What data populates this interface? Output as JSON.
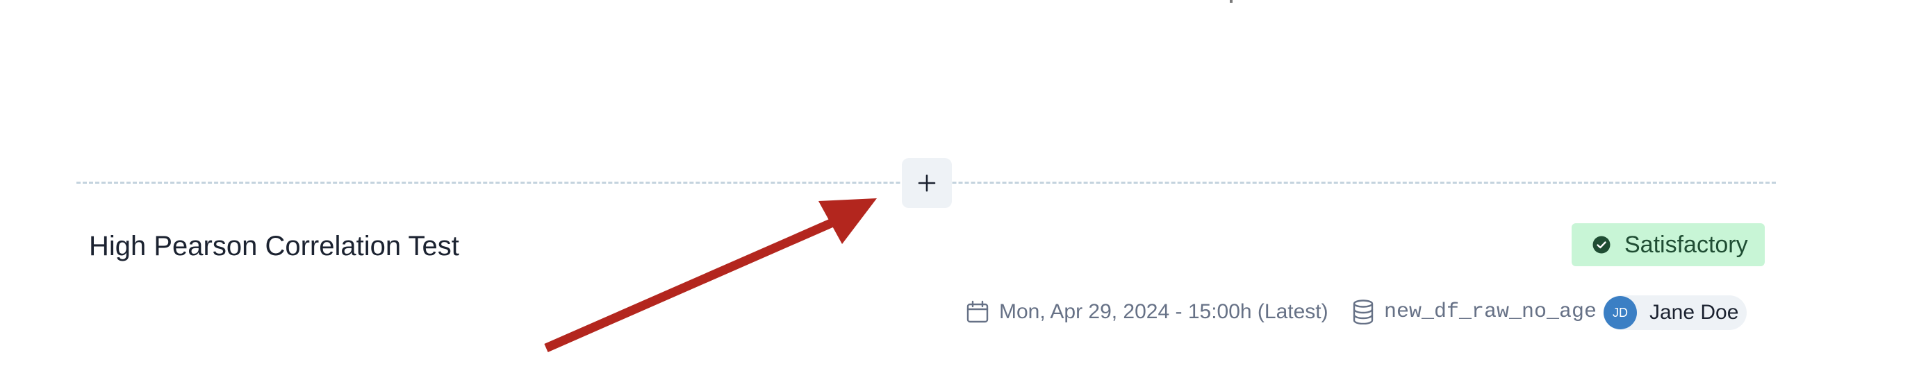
{
  "add_section": {
    "icon": "plus-icon"
  },
  "test": {
    "title": "High Pearson Correlation Test",
    "status": {
      "label": "Satisfactory",
      "icon": "check-circle-icon",
      "background": "#c8f5d6",
      "text_color": "#1f4d33",
      "icon_color": "#1f4d33"
    },
    "meta": {
      "date": "Mon, Apr 29, 2024 - 15:00h (Latest)",
      "date_icon": "calendar-icon",
      "dataset": "new_df_raw_no_age",
      "dataset_icon": "database-icon"
    },
    "author": {
      "initials": "JD",
      "name": "Jane Doe",
      "avatar_color": "#3b7fc4"
    }
  },
  "annotation": {
    "color": "#b3261e",
    "icon": "pointer-arrow"
  }
}
